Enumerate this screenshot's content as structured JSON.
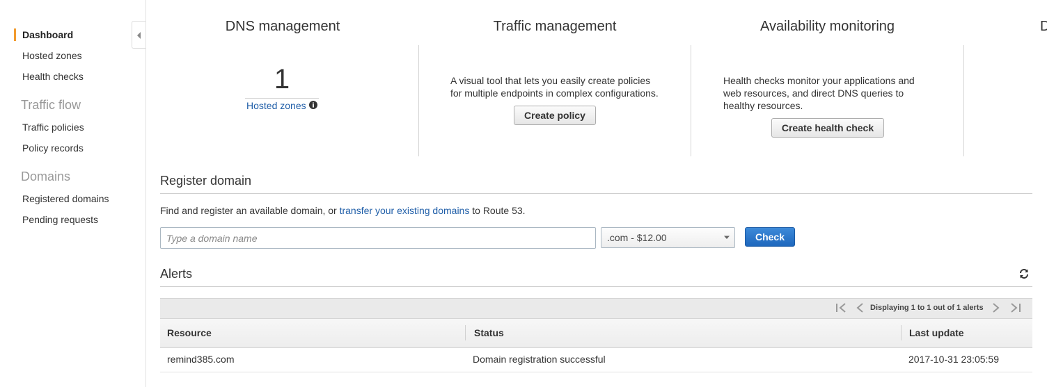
{
  "sidebar": {
    "items": [
      {
        "label": "Dashboard",
        "active": true
      },
      {
        "label": "Hosted zones"
      },
      {
        "label": "Health checks"
      }
    ],
    "sections": [
      {
        "title": "Traffic flow",
        "items": [
          {
            "label": "Traffic policies"
          },
          {
            "label": "Policy records"
          }
        ]
      },
      {
        "title": "Domains",
        "items": [
          {
            "label": "Registered domains"
          },
          {
            "label": "Pending requests"
          }
        ]
      }
    ],
    "accent_color": "#f29b2e"
  },
  "panels": {
    "dns": {
      "title": "DNS management",
      "count": "1",
      "link": "Hosted zones"
    },
    "traffic": {
      "title": "Traffic management",
      "line1": "A visual tool that lets you easily create policies",
      "line2": "for multiple endpoints in complex configurations.",
      "button": "Create policy"
    },
    "availability": {
      "title": "Availability monitoring",
      "line1": "Health checks monitor your applications and",
      "line2": "web resources, and direct DNS queries to",
      "line3": "healthy resources.",
      "button": "Create health check"
    },
    "cut_title": "D"
  },
  "register": {
    "title": "Register domain",
    "text_before": "Find and register an available domain, or ",
    "link": "transfer your existing domains",
    "text_after": " to Route 53.",
    "placeholder": "Type a domain name",
    "tld": ".com - $12.00",
    "check_button": "Check",
    "check_color": "#1e67bd"
  },
  "alerts": {
    "title": "Alerts",
    "pager": "Displaying 1 to 1 out of 1 alerts",
    "columns": [
      "Resource",
      "Status",
      "Last update"
    ],
    "rows": [
      [
        "remind385.com",
        "Domain registration successful",
        "2017-10-31 23:05:59"
      ]
    ]
  },
  "link_color": "#1f5ea8"
}
